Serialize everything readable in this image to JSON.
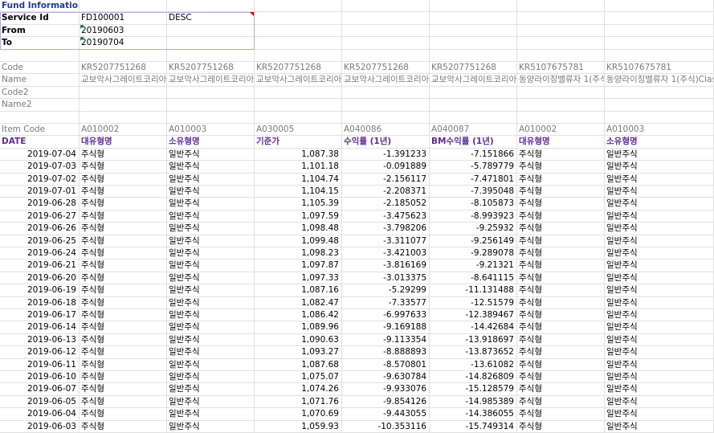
{
  "fund_info": {
    "title": "Fund Information",
    "service_id_label": "Service Id",
    "service_id_value": "FD100001",
    "service_id_extra": "DESC",
    "from_label": "From",
    "from_value": "20190603",
    "to_label": "To",
    "to_value": "20190704"
  },
  "meta": {
    "code_label": "Code",
    "name_label": "Name",
    "code2_label": "Code2",
    "name2_label": "Name2",
    "codes": [
      "KR5207751268",
      "KR5207751268",
      "KR5207751268",
      "KR5207751268",
      "KR5207751268",
      "KR5107675781",
      "KR5107675781"
    ],
    "names": [
      "교보악사그레이트코리아",
      "교보악사그레이트코리아",
      "교보악사그레이트코리아",
      "교보악사그레이트코리아",
      "교보악사그레이트코리아",
      "동양라이징밸류자 1(주식",
      "동양라이징밸류자 1(주식)Clas"
    ]
  },
  "table": {
    "item_code_label": "Item Code",
    "item_codes": [
      "A010002",
      "A010003",
      "A030005",
      "A040086",
      "A040087",
      "A010002",
      "A010003"
    ],
    "date_label": "DATE",
    "headers": [
      "대유형명",
      "소유형명",
      "기준가",
      "수익률 (1년)",
      "BM수익률 (1년)",
      "대유형명",
      "소유형명"
    ],
    "rows": [
      [
        "2019-07-04",
        "주식형",
        "일반주식",
        "1,087.38",
        "-1.391233",
        "-7.151866",
        "주식형",
        "일반주식"
      ],
      [
        "2019-07-03",
        "주식형",
        "일반주식",
        "1,101.18",
        "-0.091889",
        "-5.789779",
        "주식형",
        "일반주식"
      ],
      [
        "2019-07-02",
        "주식형",
        "일반주식",
        "1,104.74",
        "-2.156117",
        "-7.471801",
        "주식형",
        "일반주식"
      ],
      [
        "2019-07-01",
        "주식형",
        "일반주식",
        "1,104.15",
        "-2.208371",
        "-7.395048",
        "주식형",
        "일반주식"
      ],
      [
        "2019-06-28",
        "주식형",
        "일반주식",
        "1,105.39",
        "-2.185052",
        "-8.105873",
        "주식형",
        "일반주식"
      ],
      [
        "2019-06-27",
        "주식형",
        "일반주식",
        "1,097.59",
        "-3.475623",
        "-8.993923",
        "주식형",
        "일반주식"
      ],
      [
        "2019-06-26",
        "주식형",
        "일반주식",
        "1,098.48",
        "-3.798206",
        "-9.25932",
        "주식형",
        "일반주식"
      ],
      [
        "2019-06-25",
        "주식형",
        "일반주식",
        "1,099.48",
        "-3.311077",
        "-9.256149",
        "주식형",
        "일반주식"
      ],
      [
        "2019-06-24",
        "주식형",
        "일반주식",
        "1,098.23",
        "-3.421003",
        "-9.289078",
        "주식형",
        "일반주식"
      ],
      [
        "2019-06-21",
        "주식형",
        "일반주식",
        "1,097.87",
        "-3.816169",
        "-9.21321",
        "주식형",
        "일반주식"
      ],
      [
        "2019-06-20",
        "주식형",
        "일반주식",
        "1,097.33",
        "-3.013375",
        "-8.641115",
        "주식형",
        "일반주식"
      ],
      [
        "2019-06-19",
        "주식형",
        "일반주식",
        "1,087.16",
        "-5.29299",
        "-11.131488",
        "주식형",
        "일반주식"
      ],
      [
        "2019-06-18",
        "주식형",
        "일반주식",
        "1,082.47",
        "-7.33577",
        "-12.51579",
        "주식형",
        "일반주식"
      ],
      [
        "2019-06-17",
        "주식형",
        "일반주식",
        "1,086.42",
        "-6.997633",
        "-12.389467",
        "주식형",
        "일반주식"
      ],
      [
        "2019-06-14",
        "주식형",
        "일반주식",
        "1,089.96",
        "-9.169188",
        "-14.42684",
        "주식형",
        "일반주식"
      ],
      [
        "2019-06-13",
        "주식형",
        "일반주식",
        "1,090.63",
        "-9.113354",
        "-13.918697",
        "주식형",
        "일반주식"
      ],
      [
        "2019-06-12",
        "주식형",
        "일반주식",
        "1,093.27",
        "-8.888893",
        "-13.873652",
        "주식형",
        "일반주식"
      ],
      [
        "2019-06-11",
        "주식형",
        "일반주식",
        "1,087.68",
        "-8.570801",
        "-13.61082",
        "주식형",
        "일반주식"
      ],
      [
        "2019-06-10",
        "주식형",
        "일반주식",
        "1,075.07",
        "-9.630784",
        "-14.826809",
        "주식형",
        "일반주식"
      ],
      [
        "2019-06-07",
        "주식형",
        "일반주식",
        "1,074.26",
        "-9.933076",
        "-15.128579",
        "주식형",
        "일반주식"
      ],
      [
        "2019-06-05",
        "주식형",
        "일반주식",
        "1,071.76",
        "-9.854126",
        "-14.985389",
        "주식형",
        "일반주식"
      ],
      [
        "2019-06-04",
        "주식형",
        "일반주식",
        "1,070.69",
        "-9.443055",
        "-14.386055",
        "주식형",
        "일반주식"
      ],
      [
        "2019-06-03",
        "주식형",
        "일반주식",
        "1,059.93",
        "-10.353116",
        "-15.749314",
        "주식형",
        "일반주식"
      ]
    ]
  },
  "colors": {
    "title_blue": "#1f3b8f",
    "header_purple": "#5c2d91",
    "gridline": "#e0e0e0",
    "comment_marker": "#d00000",
    "error_marker": "#1e8a3c"
  }
}
